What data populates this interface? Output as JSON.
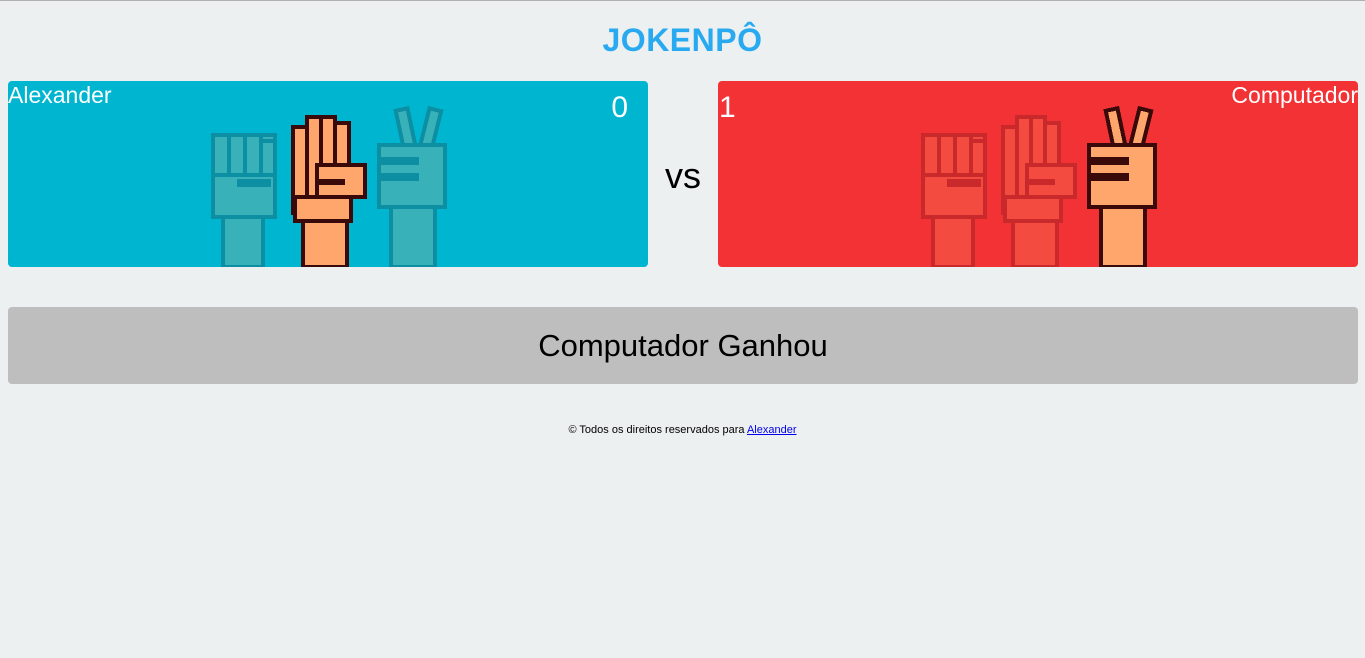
{
  "title": "JOKENPÔ",
  "player": {
    "name": "Alexander",
    "score": "0",
    "selected": "paper",
    "choices": [
      "rock-icon",
      "paper-icon",
      "scissors-icon"
    ]
  },
  "computer": {
    "name": "Computador",
    "score": "1",
    "selected": "scissors",
    "choices": [
      "rock-icon",
      "paper-icon",
      "scissors-icon"
    ]
  },
  "vs_label": "vs",
  "result_text": "Computador Ganhou",
  "footer": {
    "text": "© Todos os direitos reservados para ",
    "link": "Alexander"
  },
  "colors": {
    "title": "#29aaf0",
    "player_panel": "#00b5cf",
    "computer_panel": "#f23235",
    "skin": "#ffa66d",
    "outline": "#3a0a0a",
    "result_bg": "#bebebe",
    "page_bg": "#ecf0f1"
  }
}
